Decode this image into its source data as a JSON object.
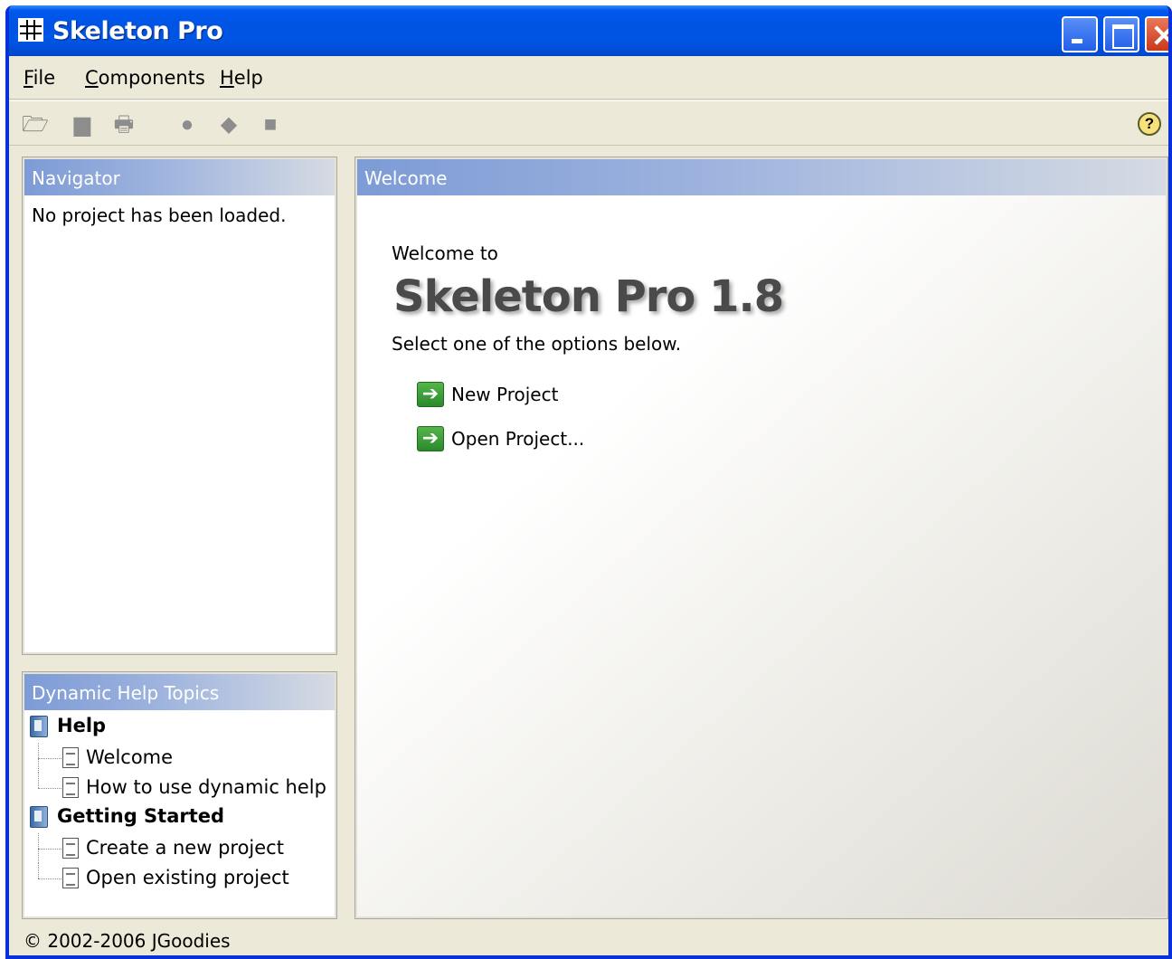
{
  "window": {
    "title": "Skeleton Pro",
    "controls": [
      "minimize",
      "maximize",
      "close"
    ]
  },
  "menu": {
    "file": {
      "mnemonic": "F",
      "rest": "ile"
    },
    "components": {
      "mnemonic": "C",
      "rest": "omponents"
    },
    "help": {
      "mnemonic": "H",
      "rest": "elp"
    }
  },
  "toolbar": {
    "icons": [
      "open-folder-icon",
      "save-icon",
      "print-icon",
      "bomb-icon",
      "tag-icon",
      "export-icon",
      "help-icon"
    ],
    "open": "🗁",
    "save": "▆",
    "print": "🖶",
    "t4": "●",
    "t5": "◆",
    "t6": "■",
    "help": "?"
  },
  "navigator": {
    "header": "Navigator",
    "message": "No project has been loaded."
  },
  "dynamic_help": {
    "header": "Dynamic Help Topics",
    "groups": [
      {
        "label": "Help",
        "items": [
          "Welcome",
          "How to use dynamic help"
        ]
      },
      {
        "label": "Getting Started",
        "items": [
          "Create a new project",
          "Open existing project"
        ]
      }
    ]
  },
  "welcome": {
    "header": "Welcome",
    "intro": "Welcome to",
    "product": "Skeleton Pro 1.8",
    "instruction": "Select one of the options below.",
    "actions": [
      {
        "label": "New Project",
        "icon": "arrow-right-icon",
        "glyph": "➔"
      },
      {
        "label": "Open Project...",
        "icon": "arrow-right-icon",
        "glyph": "➔"
      }
    ]
  },
  "status": {
    "copyright": "© 2002-2006 JGoodies"
  },
  "colors": {
    "title_bar": "#0054e3",
    "panel_header": "#7d9bd6",
    "action_arrow": "#2a8a2c"
  }
}
